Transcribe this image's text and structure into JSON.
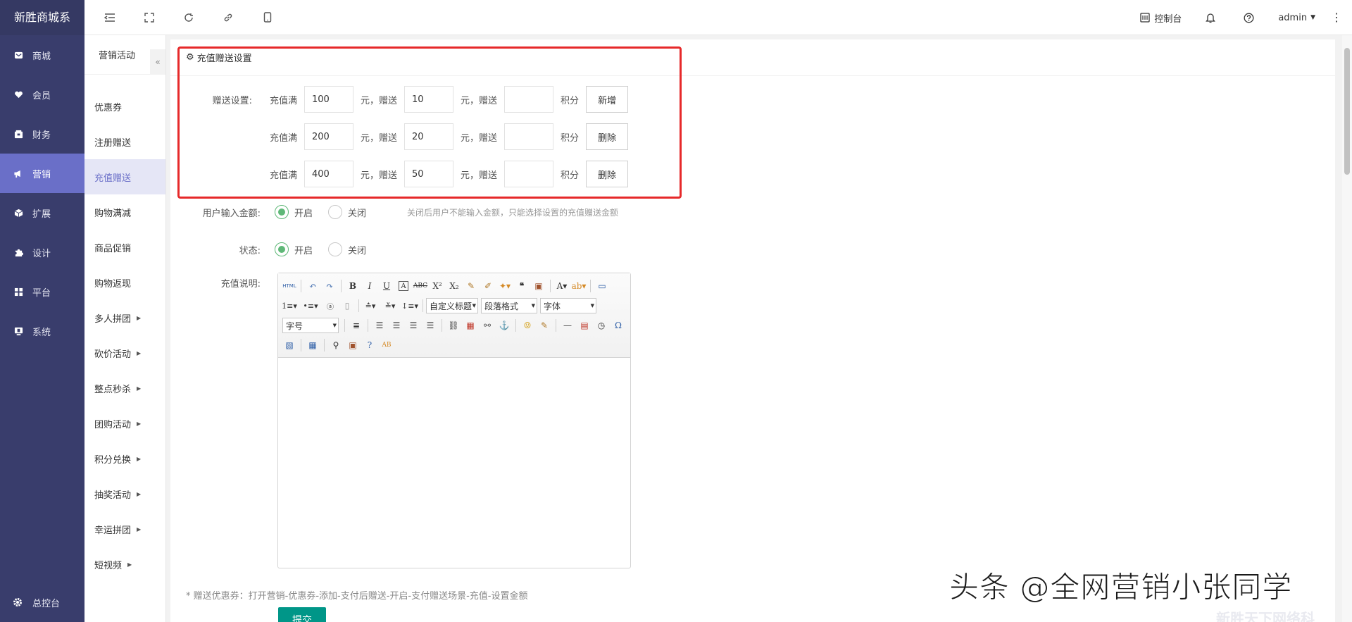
{
  "brand": "新胜商城系",
  "sidebar": {
    "items": [
      {
        "label": "商城",
        "icon": "mail-icon"
      },
      {
        "label": "会员",
        "icon": "heart-icon"
      },
      {
        "label": "财务",
        "icon": "wallet-icon"
      },
      {
        "label": "营销",
        "icon": "megaphone-icon"
      },
      {
        "label": "扩展",
        "icon": "cube-icon"
      },
      {
        "label": "设计",
        "icon": "puzzle-icon"
      },
      {
        "label": "平台",
        "icon": "grid-icon"
      },
      {
        "label": "系统",
        "icon": "monitor-icon"
      }
    ],
    "active_index": 3,
    "bottom": "总控台"
  },
  "topbar": {
    "console": "控制台",
    "user": "admin"
  },
  "subnav": {
    "title": "营销活动",
    "collapse": "«",
    "items": [
      {
        "label": "优惠券"
      },
      {
        "label": "注册赠送"
      },
      {
        "label": "充值赠送"
      },
      {
        "label": "购物满减"
      },
      {
        "label": "商品促销"
      },
      {
        "label": "购物返现"
      },
      {
        "label": "多人拼团"
      },
      {
        "label": "砍价活动"
      },
      {
        "label": "整点秒杀"
      },
      {
        "label": "团购活动"
      },
      {
        "label": "积分兑换"
      },
      {
        "label": "抽奖活动"
      },
      {
        "label": "幸运拼团"
      },
      {
        "label": "短视频"
      }
    ],
    "active_index": 2
  },
  "card": {
    "title": "充值赠送设置"
  },
  "gift": {
    "label": "赠送设置:",
    "prefix": "充值满",
    "mid": "元，赠送",
    "mid2": "元，赠送",
    "suffix": "积分",
    "rows": [
      {
        "amount": "100",
        "gift": "10",
        "points": "",
        "button": "新增"
      },
      {
        "amount": "200",
        "gift": "20",
        "points": "",
        "button": "删除"
      },
      {
        "amount": "400",
        "gift": "50",
        "points": "",
        "button": "删除"
      }
    ]
  },
  "user_input": {
    "label": "用户输入金额:",
    "on": "开启",
    "off": "关闭",
    "hint": "关闭后用户不能输入金额，只能选择设置的充值赠送金额"
  },
  "status": {
    "label": "状态:",
    "on": "开启",
    "off": "关闭"
  },
  "description": {
    "label": "充值说明:",
    "toolbar": {
      "custom_title": "自定义标题",
      "paragraph": "段落格式",
      "font": "字体",
      "size": "字号"
    }
  },
  "note": "* 赠送优惠券：打开营销-优惠券-添加-支付后赠送-开启-支付赠送场景-充值-设置金额",
  "submit": "提交",
  "watermark": "头条 @全网营销小张同学",
  "watermark2": "新胜天下网络科"
}
